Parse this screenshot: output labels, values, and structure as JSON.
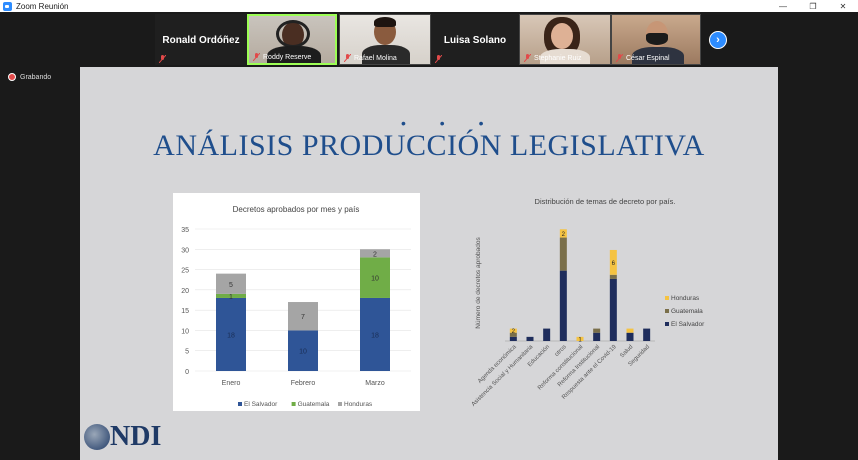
{
  "window": {
    "title": "Zoom Reunión",
    "controls": [
      "—",
      "❐",
      "✕"
    ]
  },
  "gallery": {
    "participants": [
      {
        "name": "Ronald Ordóñez",
        "video": false
      },
      {
        "name": "Roddy Reserve",
        "video": true
      },
      {
        "name": "Rafael Molina",
        "video": true
      },
      {
        "name": "Luisa Solano",
        "video": false
      },
      {
        "name": "Stephanie Ruiz",
        "video": true
      },
      {
        "name": "César Espinal",
        "video": true
      }
    ],
    "next_icon": "chevron-right-icon",
    "next_glyph": "›"
  },
  "recording": {
    "label": "Grabando",
    "color": "#e24a4a"
  },
  "slide": {
    "dots": "• • •",
    "title": "ANÁLISIS PRODUCCIÓN LEGISLATIVA",
    "title_color": "#1f4e8c",
    "logo_text": "NDI"
  },
  "colors": {
    "el_salvador": "#2f5597",
    "guatemala": "#70ad47",
    "honduras": "#a5a5a5",
    "c2_el_salvador": "#1f2d5c",
    "c2_guatemala": "#7a6f4a",
    "c2_honduras": "#f5c342"
  },
  "chart_data": [
    {
      "type": "bar",
      "stacked": true,
      "title": "Decretos aprobados por mes y país",
      "categories": [
        "Enero",
        "Febrero",
        "Marzo"
      ],
      "series": [
        {
          "name": "El Salvador",
          "values": [
            18,
            10,
            18
          ],
          "labels": [
            "18",
            "10",
            "18"
          ]
        },
        {
          "name": "Guatemala",
          "values": [
            1,
            0,
            10
          ],
          "labels": [
            "1",
            "",
            "10"
          ]
        },
        {
          "name": "Honduras",
          "values": [
            5,
            7,
            2
          ],
          "labels": [
            "5",
            "7",
            "2"
          ]
        }
      ],
      "ylim": [
        0,
        35
      ],
      "yticks": [
        0,
        5,
        10,
        15,
        20,
        25,
        30,
        35
      ],
      "legend": "bottom"
    },
    {
      "type": "bar",
      "stacked": true,
      "title": "Distribución de temas de decreto por país.",
      "ylabel": "Número de decretos aprobados",
      "categories": [
        "Agenda económica",
        "Asistencia Social y Humanitaria",
        "Educación",
        "otros",
        "Reforma constitucional",
        "Reforma Institucional",
        "Respuesta ante el Covid-19",
        "Salud",
        "Seguridad"
      ],
      "series": [
        {
          "name": "El Salvador",
          "values": [
            1,
            1,
            3,
            17,
            0,
            2,
            15,
            2,
            3
          ],
          "labels": [
            "",
            "",
            "",
            "",
            "",
            "",
            "",
            "",
            ""
          ]
        },
        {
          "name": "Guatemala",
          "values": [
            1,
            0,
            0,
            8,
            0,
            1,
            1,
            0,
            0
          ],
          "labels": [
            "",
            "",
            "",
            "",
            "",
            "",
            "",
            "",
            ""
          ]
        },
        {
          "name": "Honduras",
          "values": [
            1,
            0,
            0,
            2,
            1,
            0,
            6,
            1,
            0
          ],
          "labels": [
            "2",
            "",
            "",
            "2",
            "1",
            "2",
            "6",
            "",
            ""
          ]
        }
      ],
      "legend": "right"
    }
  ]
}
